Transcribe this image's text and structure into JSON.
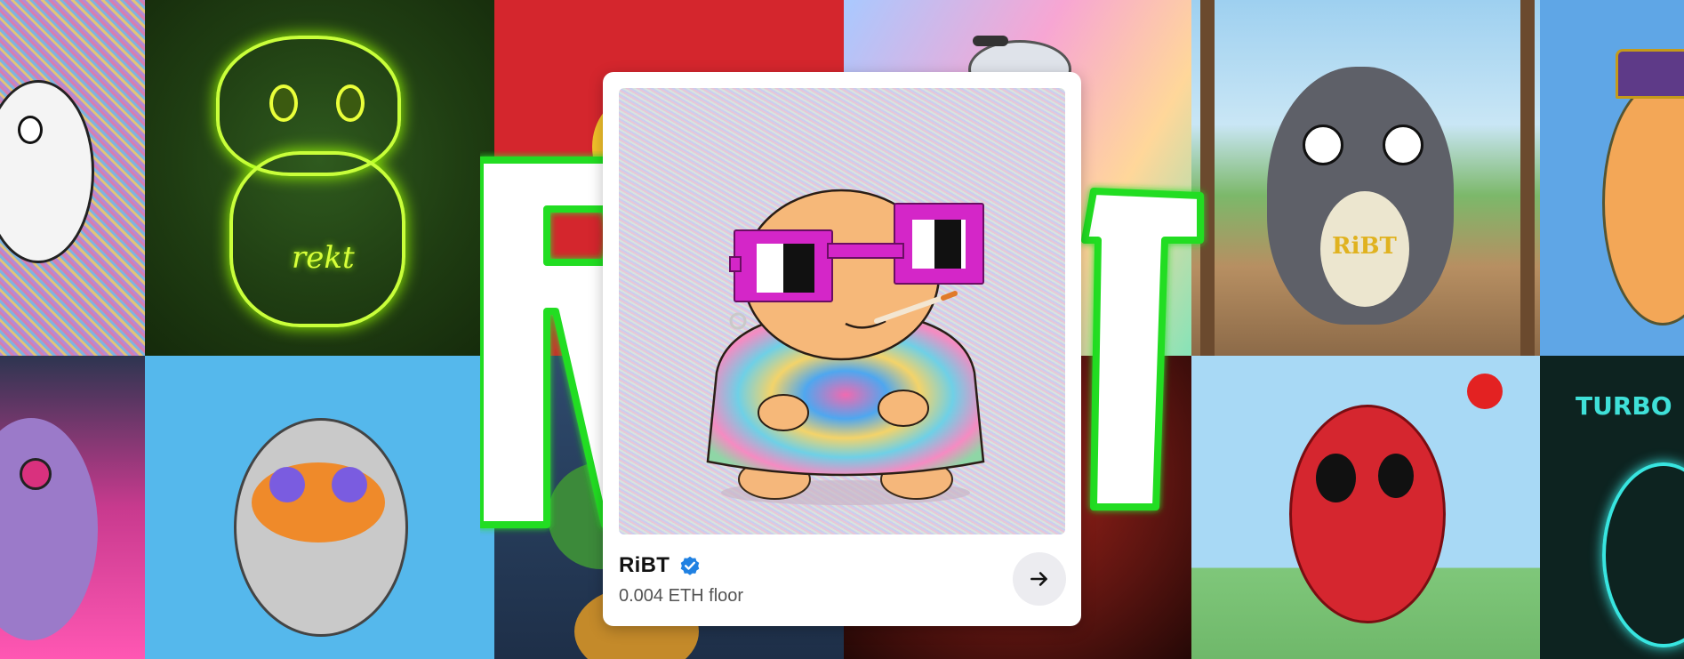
{
  "collection": {
    "name": "RiBT",
    "verified": true,
    "floor_text": "0.004 ETH floor"
  },
  "banner": {
    "overlay_text": "RiBT",
    "tile_texts": {
      "rekt": "rekt",
      "ribt_chain": "RiBT",
      "turbo": "TURBO"
    }
  },
  "icons": {
    "verified": "verified-badge-icon",
    "arrow": "arrow-right-icon"
  },
  "colors": {
    "verified_blue": "#2081e2",
    "card_bg": "#ffffff",
    "button_bg": "#ececf0",
    "neon_green": "#22dd22",
    "glasses_magenta": "#d426c8"
  }
}
